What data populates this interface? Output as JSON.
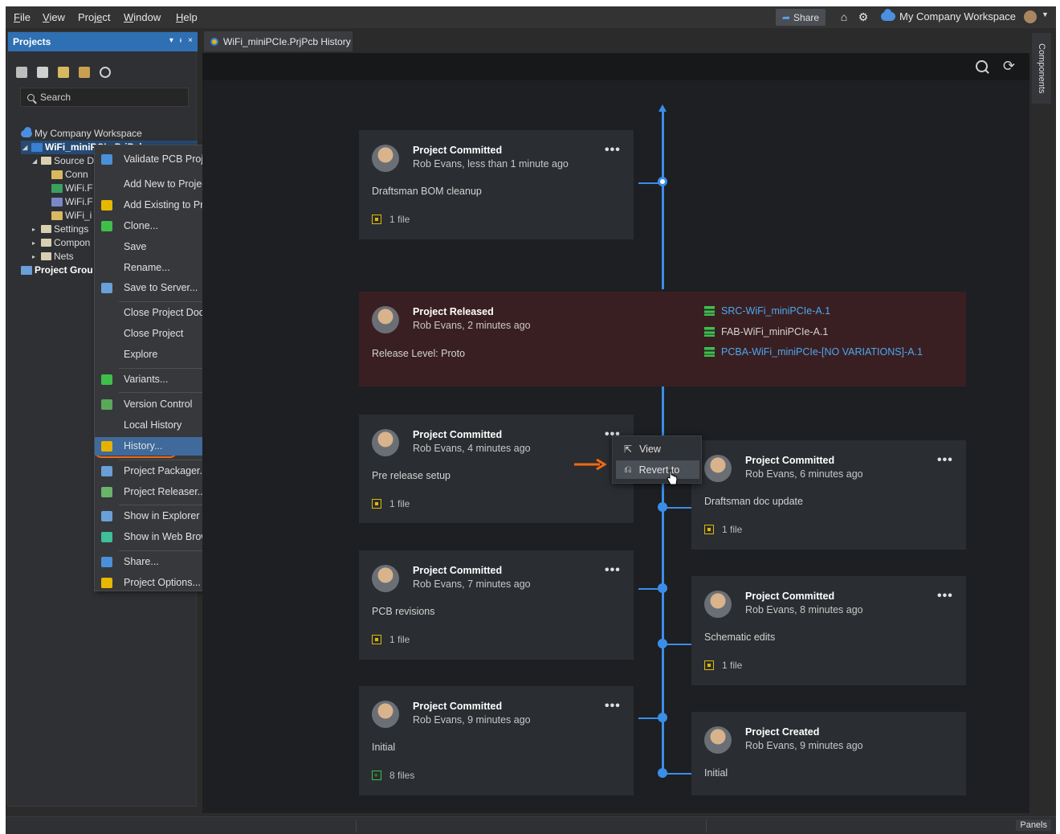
{
  "menubar": {
    "items": [
      {
        "u": "F",
        "rest": "ile"
      },
      {
        "u": "V",
        "rest": "iew"
      },
      {
        "pre": "Proj",
        "u": "e",
        "rest": "ct"
      },
      {
        "u": "W",
        "rest": "indow"
      },
      {
        "u": "H",
        "rest": "elp"
      }
    ],
    "share_label": "Share",
    "workspace_label": "My Company Workspace"
  },
  "projects_panel": {
    "title": "Projects",
    "controls": [
      "▾",
      "ᵼ",
      "×"
    ],
    "search_placeholder": "Search",
    "tree": [
      {
        "label": "My Company Workspace"
      },
      {
        "label": "WiFi_miniPCIe.PrjPcb"
      },
      {
        "label": "Source D"
      },
      {
        "label": "Conn"
      },
      {
        "label": "WiFi.F"
      },
      {
        "label": "WiFi.F"
      },
      {
        "label": "WiFi_i"
      },
      {
        "label": "Settings"
      },
      {
        "label": "Compon"
      },
      {
        "label": "Nets"
      },
      {
        "label": "Project Grou"
      }
    ]
  },
  "context_menu": {
    "items": [
      {
        "label": "Validate PCB Project WiFi_miniPCIe.PrjPcb",
        "color": "#4a90d9"
      },
      {
        "label": "Add New to Project",
        "submenu": true,
        "color": ""
      },
      {
        "label": "Add Existing to Project...",
        "color": "#e6b800"
      },
      {
        "label": "Clone...",
        "color": "#3fbf4a"
      },
      {
        "label": "Save",
        "color": ""
      },
      {
        "label": "Rename...",
        "color": ""
      },
      {
        "label": "Save to Server...",
        "color": "#6a9fd8"
      },
      {
        "label": "Close Project Documents",
        "color": ""
      },
      {
        "label": "Close Project",
        "color": ""
      },
      {
        "label": "Explore",
        "color": ""
      },
      {
        "label": "Variants...",
        "color": "#3fbf4a"
      },
      {
        "label": "Version Control",
        "submenu": true,
        "color": "#5aa85a"
      },
      {
        "label": "Local History",
        "submenu": true,
        "color": ""
      },
      {
        "label": "History...",
        "color": "#e6b200"
      },
      {
        "label": "Project Packager...",
        "color": "#6a9fd8"
      },
      {
        "label": "Project Releaser...",
        "color": "#6ab36a"
      },
      {
        "label": "Show in Explorer",
        "color": "#6a9fd8"
      },
      {
        "label": "Show in Web Browser",
        "color": "#3fbf9a"
      },
      {
        "label": "Share...",
        "color": "#4a90d9"
      },
      {
        "label": "Project Options...",
        "color": "#e6b800"
      }
    ]
  },
  "doc_tab": {
    "label": "WiFi_miniPCIe.PrjPcb History"
  },
  "history": {
    "cards": [
      {
        "title": "Project Committed",
        "sub": "Rob Evans, less than 1 minute ago",
        "desc": "Draftsman BOM cleanup",
        "files": "1 file"
      },
      {
        "title": "Project Released",
        "sub": "Rob Evans, 2 minutes ago",
        "desc": "Release Level: Proto",
        "releases": [
          "SRC-WiFi_miniPCIe-A.1",
          "FAB-WiFi_miniPCIe-A.1",
          "PCBA-WiFi_miniPCIe-[NO VARIATIONS]-A.1"
        ]
      },
      {
        "title": "Project Committed",
        "sub": "Rob Evans, 4 minutes ago",
        "desc": "Pre release setup",
        "files": "1 file"
      },
      {
        "title": "Project Committed",
        "sub": "Rob Evans, 6 minutes ago",
        "desc": "Draftsman doc update",
        "files": "1 file"
      },
      {
        "title": "Project Committed",
        "sub": "Rob Evans, 7 minutes ago",
        "desc": "PCB revisions",
        "files": "1 file"
      },
      {
        "title": "Project Committed",
        "sub": "Rob Evans, 8 minutes ago",
        "desc": "Schematic edits",
        "files": "1 file"
      },
      {
        "title": "Project Committed",
        "sub": "Rob Evans, 9 minutes ago",
        "desc": "Initial",
        "files": "8 files"
      },
      {
        "title": "Project Created",
        "sub": "Rob Evans, 9 minutes ago",
        "desc": "Initial"
      }
    ],
    "dots": "•••",
    "revert_menu": {
      "view_label": "View",
      "revert_label": "Revert to"
    }
  },
  "side_tab": {
    "label": "Components"
  },
  "statusbar": {
    "panels_label": "Panels"
  },
  "colors": {
    "accent": "#3a8ee8",
    "highlight_ring": "#f06a14",
    "release_link": "#4aa8f0"
  }
}
